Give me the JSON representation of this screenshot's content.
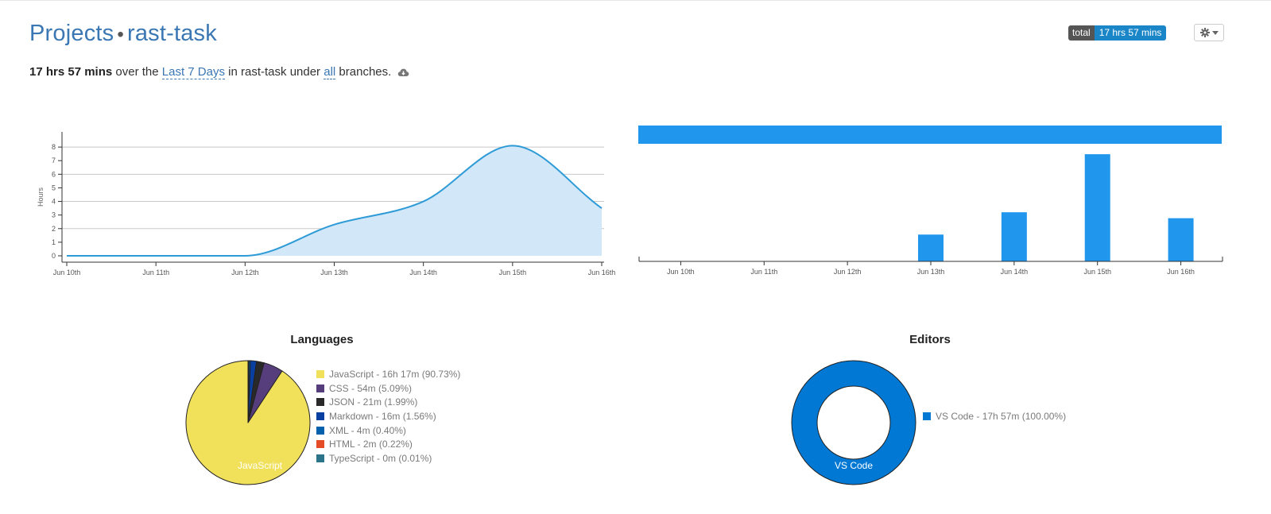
{
  "header": {
    "breadcrumb_root": "Projects",
    "separator": "•",
    "project_name": "rast-task",
    "total_badge": {
      "label": "total",
      "value": "17 hrs 57 mins"
    }
  },
  "summary": {
    "total": "17 hrs 57 mins",
    "text_over": "over the",
    "range_link": "Last 7 Days",
    "text_in": "in rast-task under",
    "branches_link": "all",
    "text_end": "branches."
  },
  "icons": {
    "cloud": "cloud-download-icon",
    "gear": "gear-icon",
    "caret": "caret-down-icon"
  },
  "colors": {
    "accent": "#3a77b3",
    "area": "#d2e8f9",
    "line": "#2e9bd6",
    "bar": "#2196ed"
  },
  "chart_data": [
    {
      "type": "area",
      "ylabel": "Hours",
      "x": [
        "Jun 10th",
        "Jun 11th",
        "Jun 12th",
        "Jun 13th",
        "Jun 14th",
        "Jun 15th",
        "Jun 16th"
      ],
      "values": [
        0.0,
        0.0,
        0.0,
        2.3,
        4.0,
        8.1,
        3.5
      ],
      "yticks": [
        0,
        1,
        2,
        3,
        4,
        5,
        6,
        7,
        8
      ],
      "ylim": [
        0,
        9
      ],
      "grid": true
    },
    {
      "type": "bar",
      "categories": [
        "Jun 10th",
        "Jun 11th",
        "Jun 12th",
        "Jun 13th",
        "Jun 14th",
        "Jun 15th",
        "Jun 16th"
      ],
      "values": [
        0,
        0,
        0,
        1.8,
        3.3,
        7.2,
        2.9
      ],
      "ylim": [
        0,
        7.9
      ]
    },
    {
      "type": "pie",
      "title": "Languages",
      "slices": [
        {
          "name": "JavaScript",
          "label": "JavaScript - 16h 17m (90.73%)",
          "value": 90.73,
          "color": "#f1e05a"
        },
        {
          "name": "CSS",
          "label": "CSS - 54m (5.09%)",
          "value": 5.09,
          "color": "#563d7c"
        },
        {
          "name": "JSON",
          "label": "JSON - 21m (1.99%)",
          "value": 1.99,
          "color": "#292929"
        },
        {
          "name": "Markdown",
          "label": "Markdown - 16m (1.56%)",
          "value": 1.56,
          "color": "#083fa1"
        },
        {
          "name": "XML",
          "label": "XML - 4m (0.40%)",
          "value": 0.4,
          "color": "#0060ac"
        },
        {
          "name": "HTML",
          "label": "HTML - 2m (0.22%)",
          "value": 0.22,
          "color": "#e34c26"
        },
        {
          "name": "TypeScript",
          "label": "TypeScript - 0m (0.01%)",
          "value": 0.01,
          "color": "#2b7489"
        }
      ],
      "slice_label": "JavaScript"
    },
    {
      "type": "pie",
      "title": "Editors",
      "donut": true,
      "slices": [
        {
          "name": "VS Code",
          "label": "VS Code - 17h 57m (100.00%)",
          "value": 100.0,
          "color": "#0078d4"
        }
      ],
      "slice_label": "VS Code"
    }
  ]
}
